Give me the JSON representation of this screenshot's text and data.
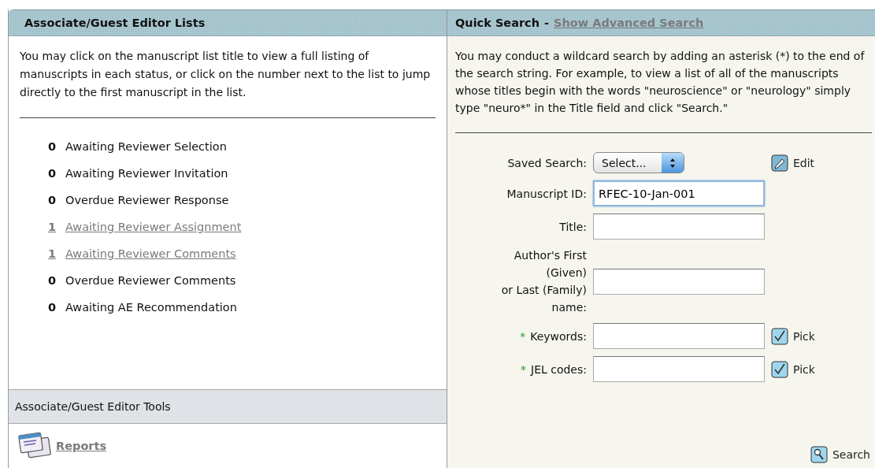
{
  "lists_panel": {
    "title": "Associate/Guest Editor Lists",
    "intro": "You may click on the manuscript list title to view a full listing of manuscripts in each status, or click on the number next to the list to jump directly to the first manuscript in the list.",
    "items": [
      {
        "count": "0",
        "label": "Awaiting Reviewer Selection",
        "kind": "plain"
      },
      {
        "count": "0",
        "label": "Awaiting Reviewer Invitation",
        "kind": "plain"
      },
      {
        "count": "0",
        "label": "Overdue Reviewer Response",
        "kind": "plain"
      },
      {
        "count": "1",
        "label": "Awaiting Reviewer Assignment",
        "kind": "link"
      },
      {
        "count": "1",
        "label": "Awaiting Reviewer Comments",
        "kind": "link"
      },
      {
        "count": "0",
        "label": "Overdue Reviewer Comments",
        "kind": "plain"
      },
      {
        "count": "0",
        "label": "Awaiting AE Recommendation",
        "kind": "plain"
      }
    ]
  },
  "tools": {
    "title": "Associate/Guest Editor Tools",
    "links": [
      {
        "label": "Reports"
      }
    ]
  },
  "search_panel": {
    "title": "Quick Search",
    "separator": "-",
    "advanced_link": "Show Advanced Search",
    "intro": "You may conduct a wildcard search by adding an asterisk (*) to the end of the search string. For example, to view a list of all of the manuscripts whose titles begin with the words \"neuroscience\" or \"neurology\" simply type \"neuro*\" in the Title field and click \"Search.\"",
    "fields": [
      {
        "kind": "select",
        "label": "Saved Search:",
        "value": "Select...",
        "action": "Edit"
      },
      {
        "kind": "text",
        "label": "Manuscript ID:",
        "value": "RFEC-10-Jan-001",
        "focused": true
      },
      {
        "kind": "text",
        "label": "Title:",
        "focused": false
      },
      {
        "kind": "text",
        "label": "Author's First\n(Given)\nor Last (Family)\nname:",
        "focused": false
      },
      {
        "kind": "pick",
        "marker": "*",
        "label": "Keywords:",
        "action": "Pick",
        "focused": false
      },
      {
        "kind": "pick",
        "marker": "*",
        "label": "JEL codes:",
        "action": "Pick",
        "focused": false
      }
    ],
    "search_button": "Search"
  }
}
